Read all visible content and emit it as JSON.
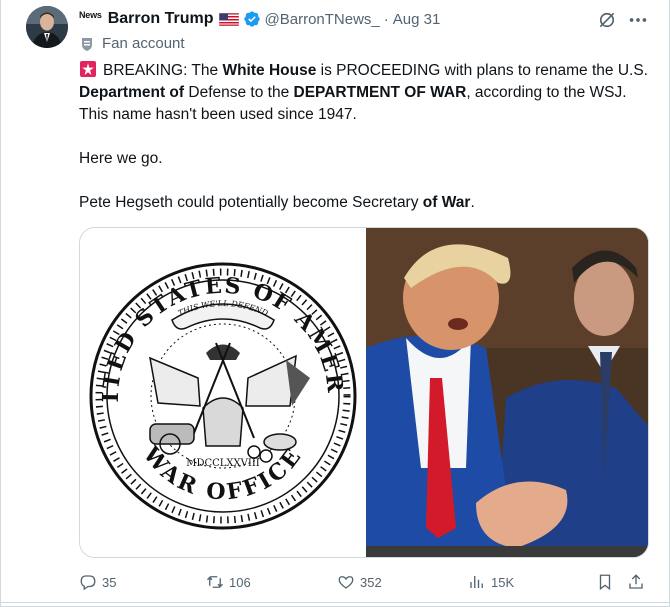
{
  "post": {
    "news_tag": "News",
    "display_name": "Barron Trump",
    "handle": "@BarronTNews_",
    "separator": "·",
    "timestamp": "Aug 31",
    "label": "Fan account",
    "text": {
      "p1_parts": [
        "BREAKING: The ",
        "White House",
        " is PROCEEDING with plans to rename the U.S. ",
        "Department of",
        " Defense to the ",
        "DEPARTMENT OF WAR",
        ", according to the WSJ. This name hasn't been used since 1947."
      ],
      "p2": "Here we go.",
      "p3_parts": [
        "Pete Hegseth could potentially become Secretary ",
        "of War",
        "."
      ]
    },
    "media": {
      "seal": {
        "top_text": "UNITED STATES OF AMERICA",
        "bottom_text": "WAR OFFICE",
        "year": "MDCCLXXVIII",
        "ribbon": "THIS WE'LL DEFEND"
      }
    },
    "actions": {
      "replies": "35",
      "reposts": "106",
      "likes": "352",
      "views": "15K"
    }
  },
  "colors": {
    "text_primary": "#0f1419",
    "text_secondary": "#536471",
    "verified_blue": "#1d9bf0",
    "border": "#cfd9de",
    "siren_red": "#e0245e"
  },
  "icons": [
    "grok-icon",
    "more-icon",
    "fan-account-icon",
    "siren-icon",
    "verified-icon",
    "flag-icon",
    "reply-icon",
    "repost-icon",
    "like-icon",
    "views-icon",
    "bookmark-icon",
    "share-icon"
  ]
}
